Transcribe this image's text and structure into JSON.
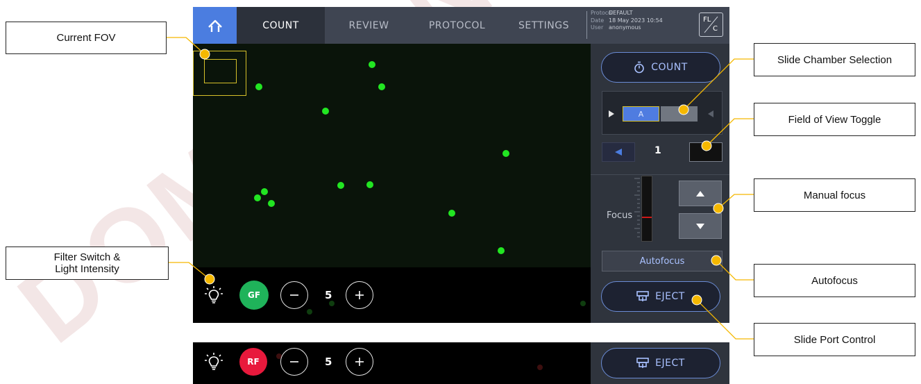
{
  "callouts": {
    "current_fov": "Current FOV",
    "slide_chamber": "Slide Chamber Selection",
    "fov_toggle": "Field of View Toggle",
    "manual_focus": "Manual focus",
    "filter_switch_line1": "Filter Switch &",
    "filter_switch_line2": "Light Intensity",
    "autofocus": "Autofocus",
    "slide_port": "Slide Port Control"
  },
  "callout_color": "#f5b800",
  "watermark": "DOMINION",
  "nav": {
    "tabs": [
      "COUNT",
      "REVIEW",
      "PROTOCOL",
      "SETTINGS"
    ],
    "active_tab": "COUNT",
    "home_icon": "home-icon"
  },
  "info": {
    "protocol_key": "Protocol",
    "protocol_val": "DEFAULT",
    "date_key": "Date",
    "date_val": "18 May 2023 10:54",
    "user_key": "User",
    "user_val": "anonymous"
  },
  "mode": {
    "top": "FL",
    "bottom": "C"
  },
  "panel": {
    "count_label": "COUNT",
    "chamber_a": "A",
    "fov_number": "1",
    "focus_label": "Focus",
    "autofocus_label": "Autofocus",
    "eject_label": "EJECT"
  },
  "controls": {
    "filter_gf": "GF",
    "filter_rf": "RF",
    "level_gf": "5",
    "level_rf": "5",
    "colors": {
      "gf": "#1fb35a",
      "rf": "#e8193c",
      "cell": "#22e622",
      "accent": "#4b7de0"
    }
  }
}
